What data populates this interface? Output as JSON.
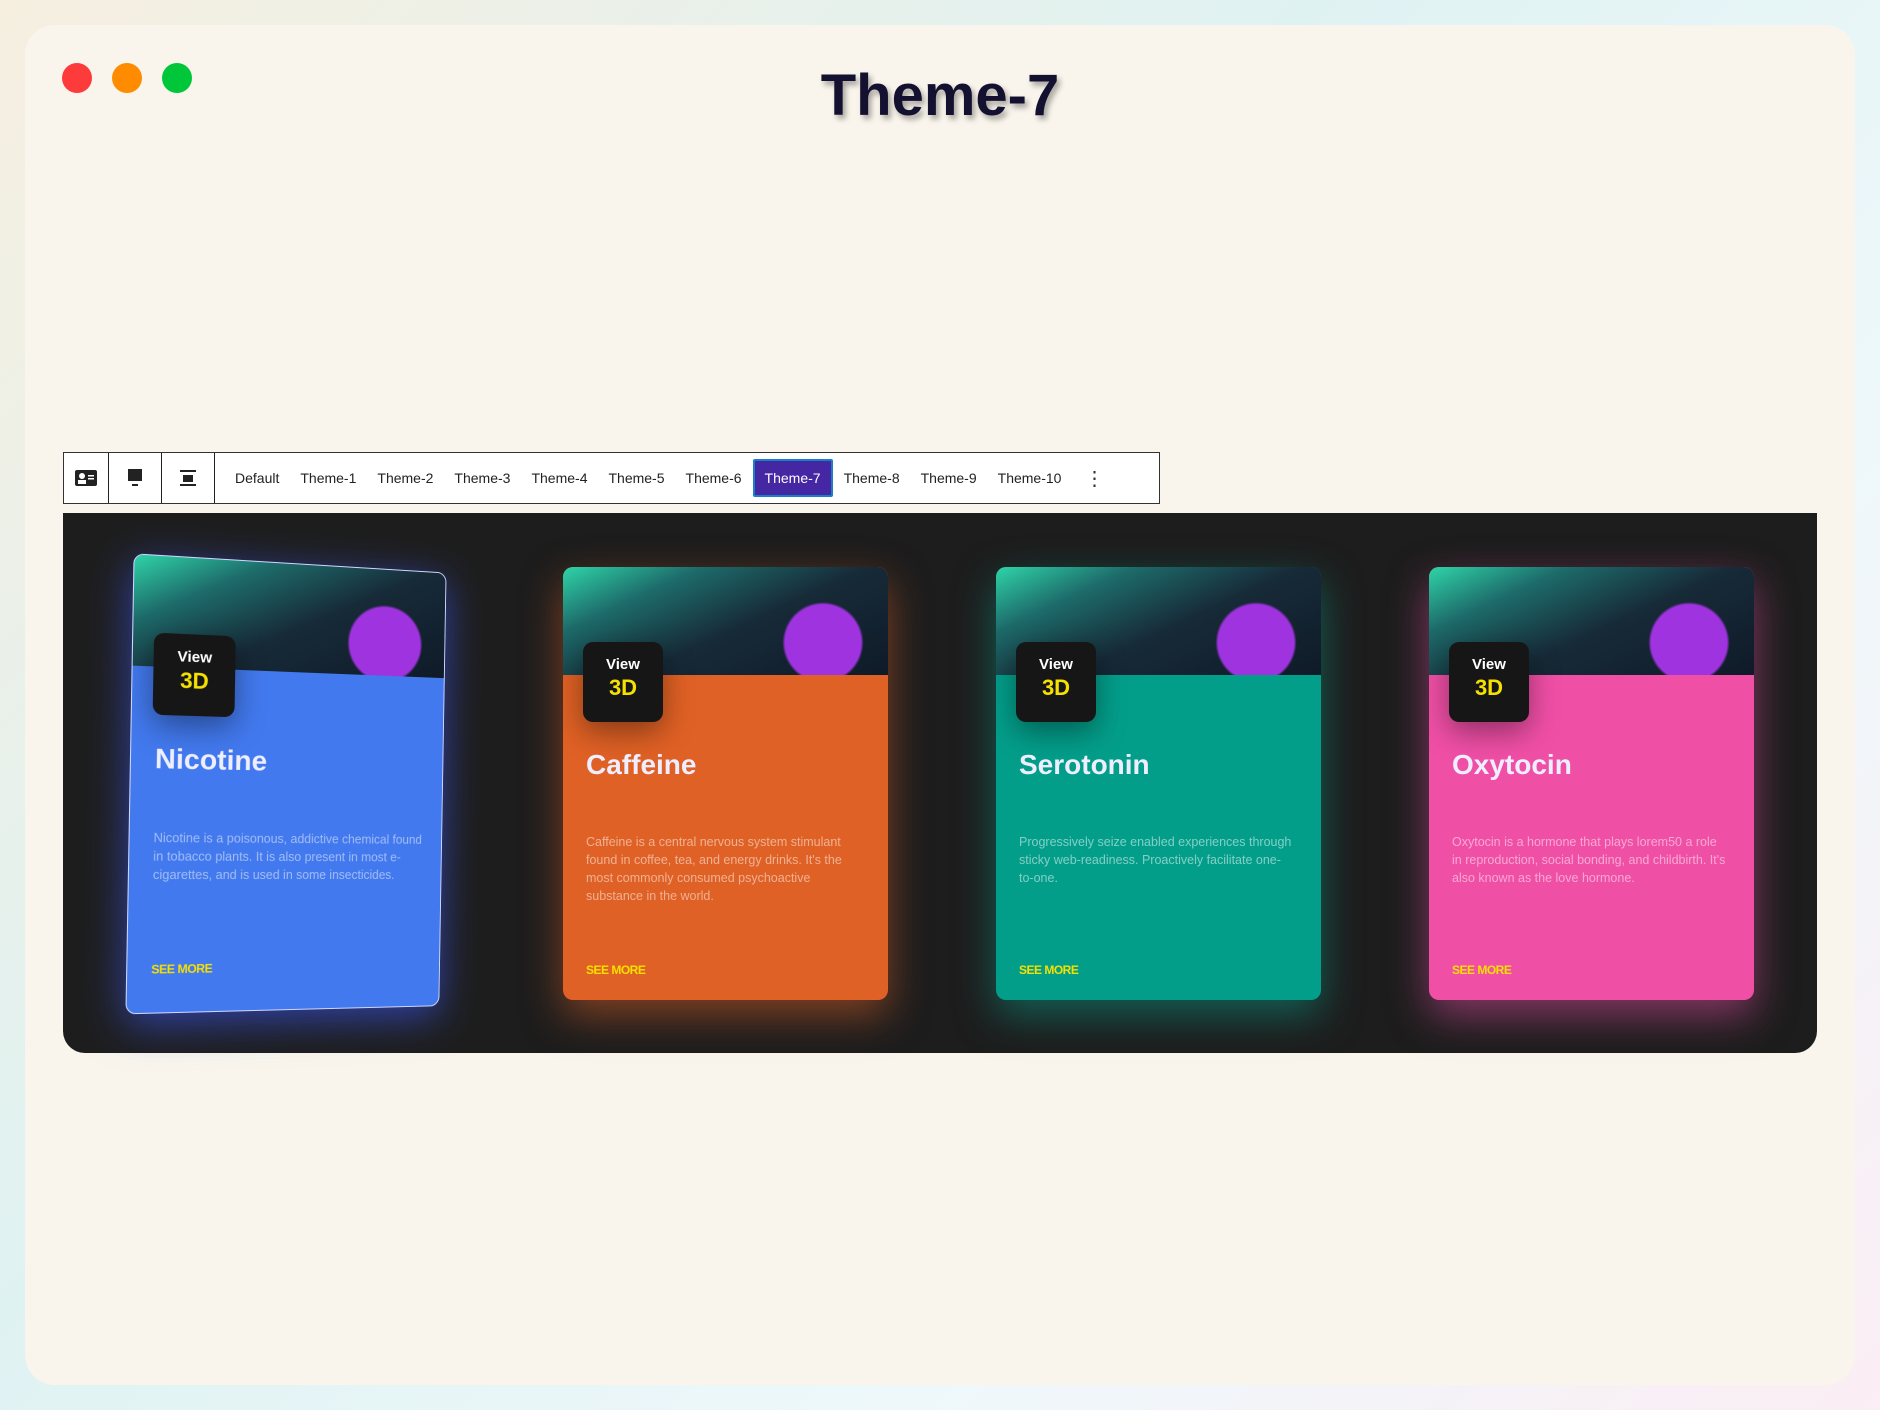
{
  "window": {
    "title": "Theme-7",
    "colors": {
      "close": "#fe3b3b",
      "minimize": "#ff8c00",
      "maximize": "#00c73a"
    }
  },
  "toolbar": {
    "icons": [
      "id-card-icon",
      "desktop-icon",
      "align-center-icon"
    ],
    "tabs": [
      "Default",
      "Theme-1",
      "Theme-2",
      "Theme-3",
      "Theme-4",
      "Theme-5",
      "Theme-6",
      "Theme-7",
      "Theme-8",
      "Theme-9",
      "Theme-10"
    ],
    "active_tab": "Theme-7",
    "more": "⋮"
  },
  "cards": [
    {
      "badge_top": "View",
      "badge_bottom": "3D",
      "title": "Nicotine",
      "text": "Nicotine is a poisonous, addictive chemical found in tobacco plants. It is also present in most e-cigarettes, and is used in some insecticides.",
      "link": "SEE MORE",
      "color": "#4279ee"
    },
    {
      "badge_top": "View",
      "badge_bottom": "3D",
      "title": "Caffeine",
      "text": "Caffeine is a central nervous system stimulant found in coffee, tea, and energy drinks. It's the most commonly consumed psychoactive substance in the world.",
      "link": "SEE MORE",
      "color": "#e06125"
    },
    {
      "badge_top": "View",
      "badge_bottom": "3D",
      "title": "Serotonin",
      "text": "Progressively seize enabled experiences through sticky web-readiness. Proactively facilitate one-to-one.",
      "link": "SEE MORE",
      "color": "#039e8a"
    },
    {
      "badge_top": "View",
      "badge_bottom": "3D",
      "title": "Oxytocin",
      "text": "Oxytocin is a hormone that plays lorem50 a role in reproduction, social bonding, and childbirth. It's also known as the love hormone.",
      "link": "SEE MORE",
      "color": "#f04fa6"
    }
  ]
}
